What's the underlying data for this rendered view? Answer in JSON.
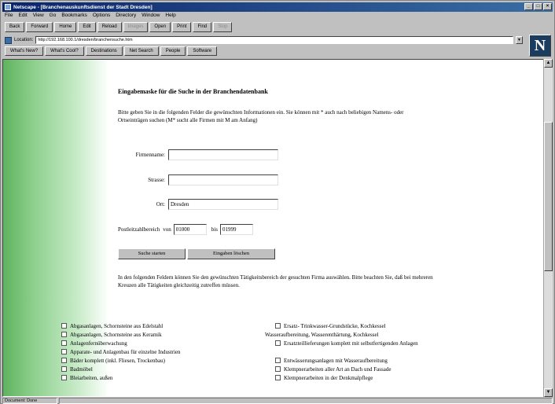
{
  "window": {
    "title": "Netscape - [Branchenauskunftsdienst der Stadt Dresden]"
  },
  "menu": [
    "File",
    "Edit",
    "View",
    "Go",
    "Bookmarks",
    "Options",
    "Directory",
    "Window",
    "Help"
  ],
  "toolbar": {
    "buttons": [
      "Back",
      "Forward",
      "Home",
      "Edit",
      "Reload",
      "Images",
      "Open",
      "Print",
      "Find",
      "Stop"
    ]
  },
  "location": {
    "label": "Location:",
    "url": "http://192.168.100.1/dresden/branchensuche.htm"
  },
  "directory_buttons": [
    "What's New?",
    "What's Cool?",
    "Destinations",
    "Net Search",
    "People",
    "Software"
  ],
  "form": {
    "title": "Eingabemaske für die Suche in der Branchendatenbank",
    "intro": "Bitte geben Sie in die folgenden Felder die gewünschten Informationen ein. Sie können mit * auch nach beliebigen Namens- oder Ortseinträgen suchen (M* sucht alle Firmen mit M am Anfang)",
    "fields": {
      "firmenname": {
        "label": "Firmenname:",
        "value": ""
      },
      "strasse": {
        "label": "Strasse:",
        "value": ""
      },
      "ort": {
        "label": "Ort:",
        "value": "Dresden"
      }
    },
    "plz": {
      "label": "Postleitzahlbereich",
      "von_label": "von",
      "von_value": "01000",
      "bis_label": "bis",
      "bis_value": "01999"
    },
    "buttons": {
      "search": "Suche starten",
      "reset": "Eingaben löschen"
    },
    "note": "In den folgenden Feldern können Sie den gewünschten Tätigkeitsbereich der gesuchten Firma auswählen. Bitte beachten Sie, daß bei mehreren Kreuzen alle Tätigkeiten gleichzeitig zutreffen müssen."
  },
  "checkboxes_left": [
    "Abgasanlagen, Schornsteine aus Edelstahl",
    "Abgasanlagen, Schornsteine aus Keramik",
    "Anlagenfernüberwachung",
    "Apparate- und Anlagenbau für einzelne Industrien",
    "Bäder komplett (inkl. Fliesen, Trockenbau)",
    "Badmöbel",
    "Bleiarbeiten, außen"
  ],
  "checkboxes_right": [
    {
      "label": "Ersatz- Trinkwasser-Grundstücke, Kochkessel",
      "cont": "Wasseraufbereitung, Wasserenthärtung, Kochkessel"
    },
    {
      "label": "Ersatzteillieferungen komplett mit selbstfertigenden Anlagen"
    },
    {
      "label": "Entwässerungsanlagen mit Wasseraufbereitung"
    },
    {
      "label": "Klempnerarbeiten aller Art an Dach und Fassade"
    },
    {
      "label": "Klempnerarbeiten in der Denkmalpflege"
    }
  ],
  "status": {
    "text": "Document: Done"
  }
}
